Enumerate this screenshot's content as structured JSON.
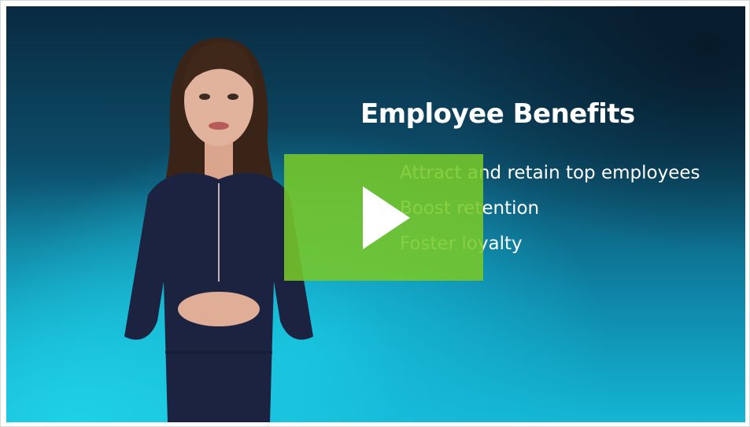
{
  "slide": {
    "title": "Employee Benefits",
    "bullets": [
      "Attract and retain top employees",
      "Boost retention",
      "Foster loyalty"
    ]
  },
  "player": {
    "play_icon": "play-icon",
    "overlay_color": "#7ac943"
  },
  "colors": {
    "background_dark": "#0a2a40",
    "background_light": "#14b6d4"
  }
}
